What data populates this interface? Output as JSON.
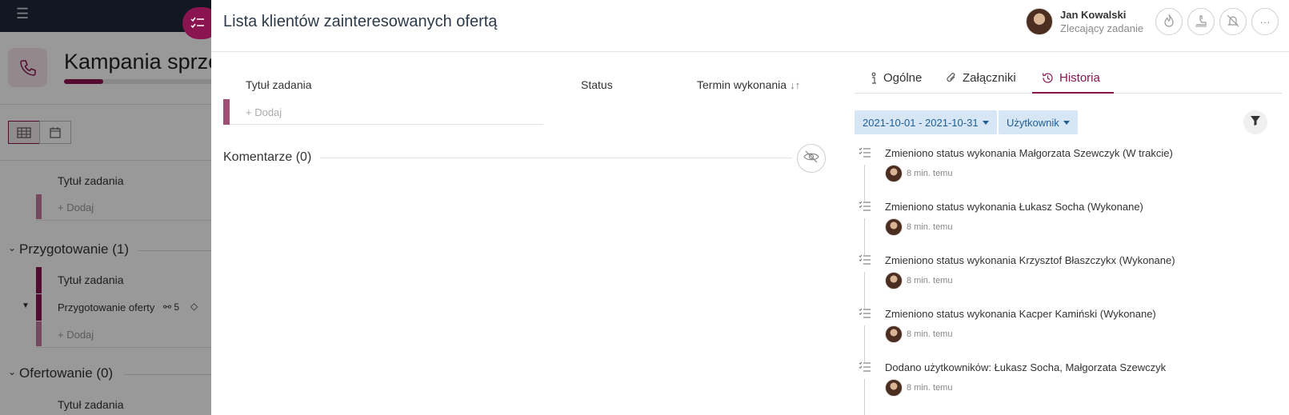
{
  "background": {
    "campaign_title": "Kampania sprzed",
    "campaign_progress": 0.26,
    "task_title_header_1": "Tytuł zadania",
    "add_label_1": "+ Dodaj",
    "section_1": "Przygotowanie (1)",
    "task_title_header_2": "Tytuł zadania",
    "task_name": "Przygotowanie oferty",
    "task_count": "5",
    "add_label_2": "+ Dodaj",
    "section_2": "Ofertowanie (0)",
    "task_title_header_3": "Tytuł zadania"
  },
  "panel": {
    "title": "Lista klientów zainteresowanych ofertą",
    "user": {
      "name": "Jan Kowalski",
      "role": "Zlecający zadanie"
    },
    "header_buttons": [
      "flame-icon",
      "hand-off-icon",
      "bell-off-icon",
      "more-icon"
    ],
    "more_label": "···"
  },
  "subtasks": {
    "columns": [
      "Tytuł zadania",
      "Status",
      "Termin wykonania"
    ],
    "add_label": "+ Dodaj"
  },
  "comments": {
    "label": "Komentarze (0)"
  },
  "tabs": [
    {
      "label": "Ogólne",
      "icon": "info-icon",
      "active": false
    },
    {
      "label": "Załączniki",
      "icon": "paperclip-icon",
      "active": false
    },
    {
      "label": "Historia",
      "icon": "history-icon",
      "active": true
    }
  ],
  "filters": {
    "date_range": "2021-10-01 - 2021-10-31",
    "user": "Użytkownik"
  },
  "history": [
    {
      "text": "Zmieniono status wykonania Małgorzata Szewczyk (W trakcie)",
      "time": "8 min. temu"
    },
    {
      "text": "Zmieniono status wykonania Łukasz Socha (Wykonane)",
      "time": "8 min. temu"
    },
    {
      "text": "Zmieniono status wykonania Krzysztof Błaszczykx (Wykonane)",
      "time": "8 min. temu"
    },
    {
      "text": "Zmieniono status wykonania Kacper Kamiński (Wykonane)",
      "time": "8 min. temu"
    },
    {
      "text": "Dodano użytkowników: Łukasz Socha, Małgorzata Szewczyk",
      "time": "8 min. temu"
    }
  ],
  "colors": {
    "accent": "#8a1450",
    "chip_bg": "#d7e6f4",
    "chip_text": "#1f5f96"
  }
}
